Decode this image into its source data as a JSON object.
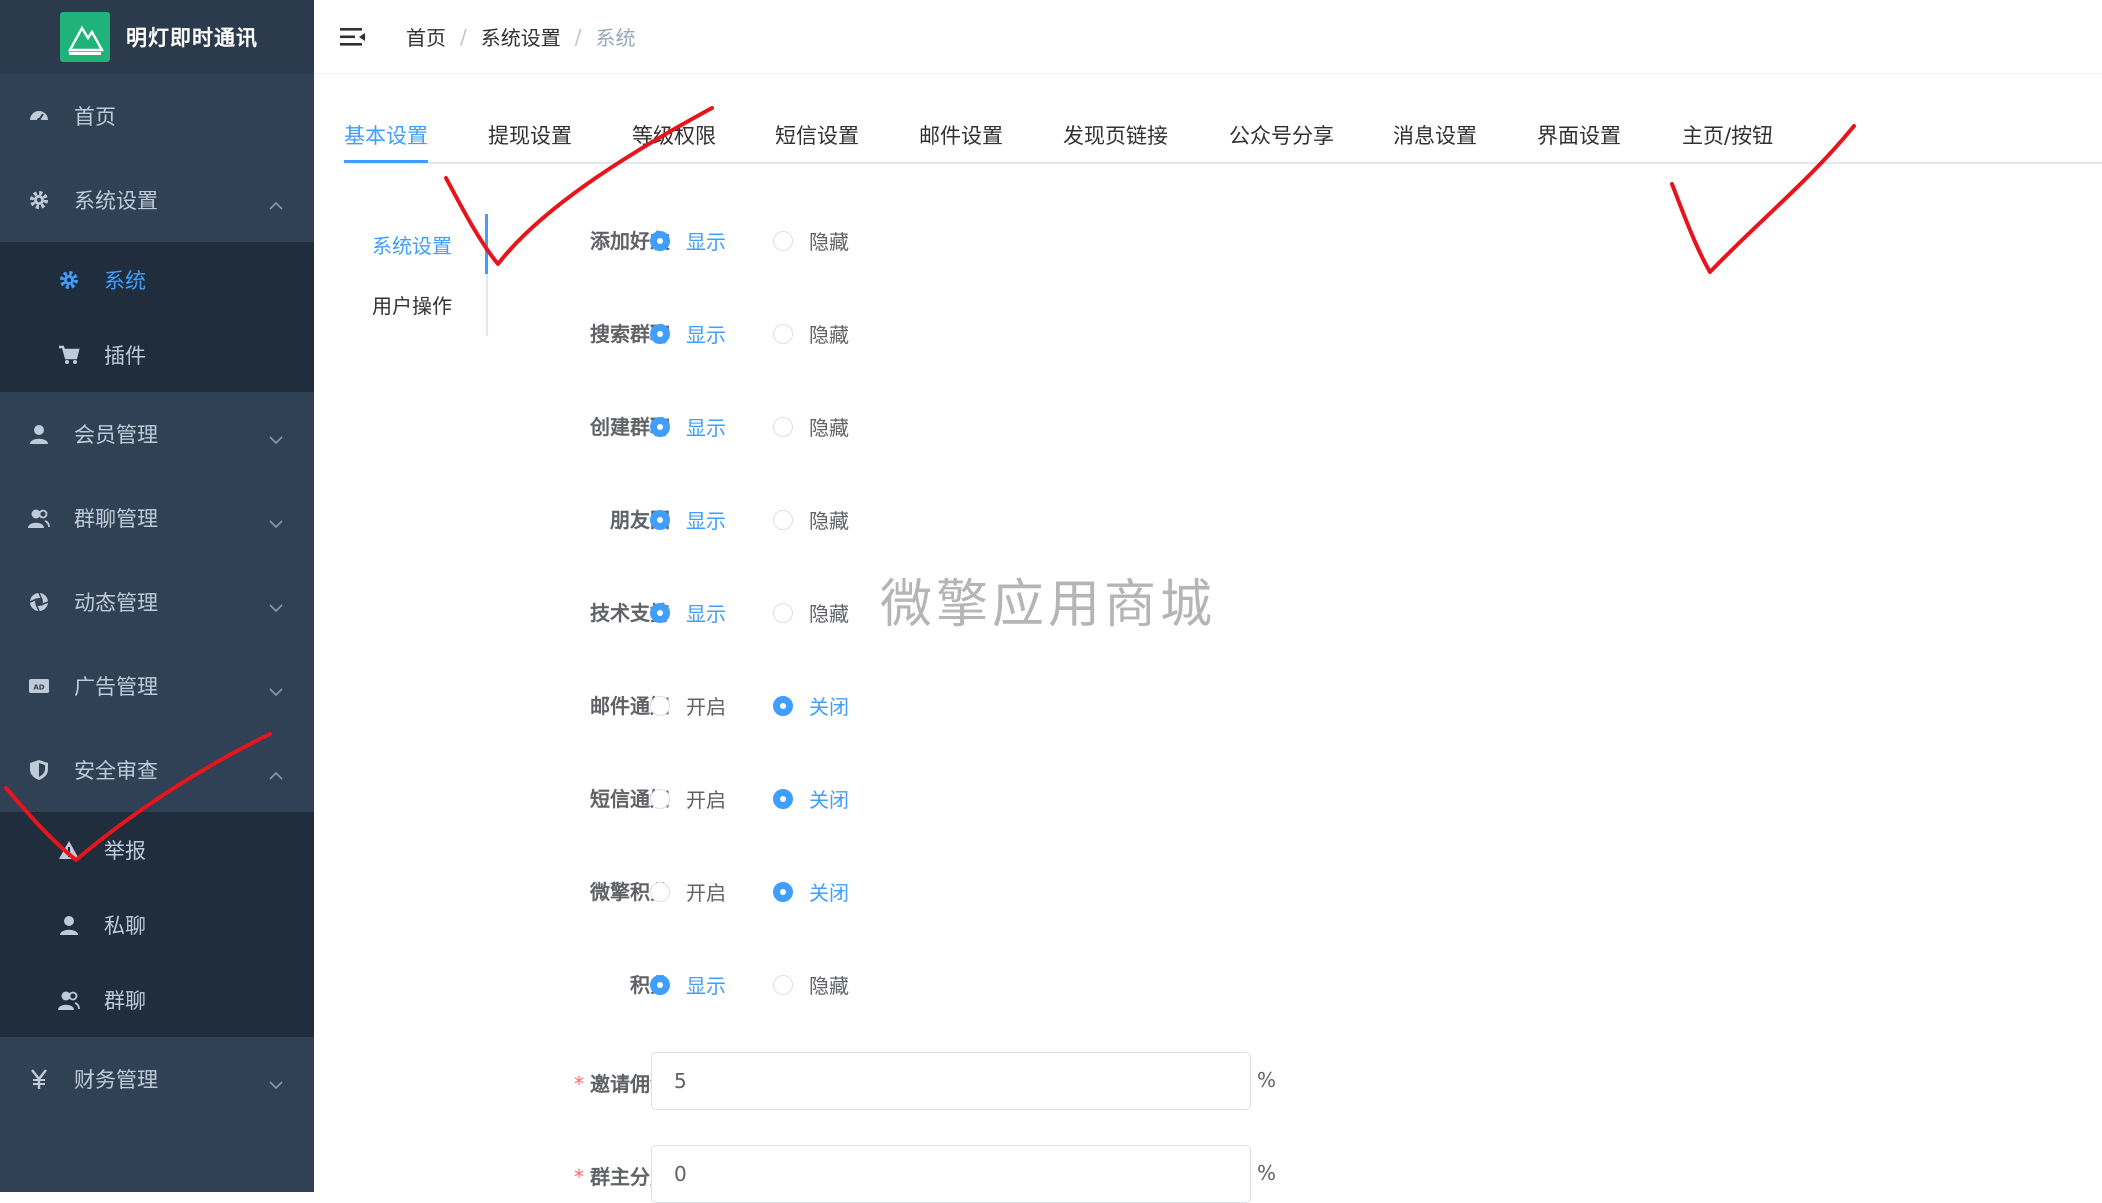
{
  "app": {
    "title": "明灯即时通讯"
  },
  "sidebar": {
    "items": [
      {
        "label": "首页",
        "icon": "dashboard-icon"
      },
      {
        "label": "系统设置",
        "icon": "gear-icon",
        "expanded": true,
        "children": [
          {
            "label": "系统",
            "icon": "gear-icon",
            "active": true
          },
          {
            "label": "插件",
            "icon": "cart-icon"
          }
        ]
      },
      {
        "label": "会员管理",
        "icon": "user-icon"
      },
      {
        "label": "群聊管理",
        "icon": "users-icon"
      },
      {
        "label": "动态管理",
        "icon": "aperture-icon"
      },
      {
        "label": "广告管理",
        "icon": "ad-icon"
      },
      {
        "label": "安全审查",
        "icon": "shield-icon",
        "expanded": true,
        "children": [
          {
            "label": "举报",
            "icon": "warning-icon"
          },
          {
            "label": "私聊",
            "icon": "user-icon"
          },
          {
            "label": "群聊",
            "icon": "users-icon"
          }
        ]
      },
      {
        "label": "财务管理",
        "icon": "yen-icon"
      }
    ]
  },
  "header": {
    "breadcrumb": [
      "首页",
      "系统设置",
      "系统"
    ],
    "separator": "/"
  },
  "tabs": [
    "基本设置",
    "提现设置",
    "等级权限",
    "短信设置",
    "邮件设置",
    "发现页链接",
    "公众号分享",
    "消息设置",
    "界面设置",
    "主页/按钮"
  ],
  "active_tab": "基本设置",
  "subtabs": [
    "系统设置",
    "用户操作"
  ],
  "active_subtab": "系统设置",
  "form": {
    "radios": [
      {
        "label": "添加好友",
        "options": [
          "显示",
          "隐藏"
        ],
        "selected": "显示"
      },
      {
        "label": "搜索群聊",
        "options": [
          "显示",
          "隐藏"
        ],
        "selected": "显示"
      },
      {
        "label": "创建群聊",
        "options": [
          "显示",
          "隐藏"
        ],
        "selected": "显示"
      },
      {
        "label": "朋友圈",
        "options": [
          "显示",
          "隐藏"
        ],
        "selected": "显示"
      },
      {
        "label": "技术支持",
        "options": [
          "显示",
          "隐藏"
        ],
        "selected": "显示"
      },
      {
        "label": "邮件通知",
        "options": [
          "开启",
          "关闭"
        ],
        "selected": "关闭"
      },
      {
        "label": "短信通知",
        "options": [
          "开启",
          "关闭"
        ],
        "selected": "关闭"
      },
      {
        "label": "微擎积分",
        "options": [
          "开启",
          "关闭"
        ],
        "selected": "关闭"
      },
      {
        "label": "积分",
        "options": [
          "显示",
          "隐藏"
        ],
        "selected": "显示"
      }
    ],
    "inputs": [
      {
        "label": "邀请佣金",
        "required": true,
        "value": "5",
        "unit": "%"
      },
      {
        "label": "群主分成",
        "required": true,
        "value": "0",
        "unit": "%"
      }
    ]
  },
  "watermark": "微擎应用商城",
  "colors": {
    "sidebar": "#304156",
    "submenu": "#1f2d3d",
    "accent": "#409eff",
    "annotation": "#e8141c"
  }
}
